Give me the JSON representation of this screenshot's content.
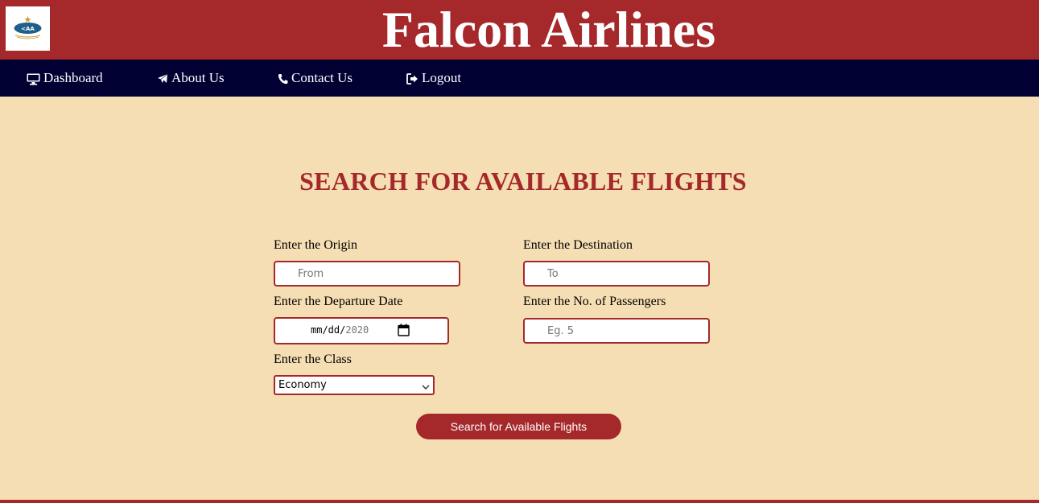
{
  "header": {
    "brand": "Falcon Airlines",
    "logo_text": "CAA"
  },
  "nav": {
    "items": [
      {
        "label": "Dashboard",
        "icon": "desktop-icon"
      },
      {
        "label": "About Us",
        "icon": "plane-icon"
      },
      {
        "label": "Contact Us",
        "icon": "phone-icon"
      },
      {
        "label": "Logout",
        "icon": "logout-icon"
      }
    ]
  },
  "main": {
    "title": "SEARCH FOR AVAILABLE FLIGHTS"
  },
  "form": {
    "origin": {
      "label": "Enter the Origin",
      "placeholder": "From"
    },
    "destination": {
      "label": "Enter the Destination",
      "placeholder": "To"
    },
    "date": {
      "label": "Enter the Departure Date",
      "value_md": "mm/dd/",
      "value_year": "2020"
    },
    "passengers": {
      "label": "Enter the No. of Passengers",
      "placeholder": "Eg. 5"
    },
    "class": {
      "label": "Enter the Class",
      "value": "Economy"
    },
    "submit_label": "Search for Available Flights"
  },
  "colors": {
    "brand": "#a5282b",
    "nav_bg": "#000033",
    "page_bg": "#f5deb3"
  }
}
